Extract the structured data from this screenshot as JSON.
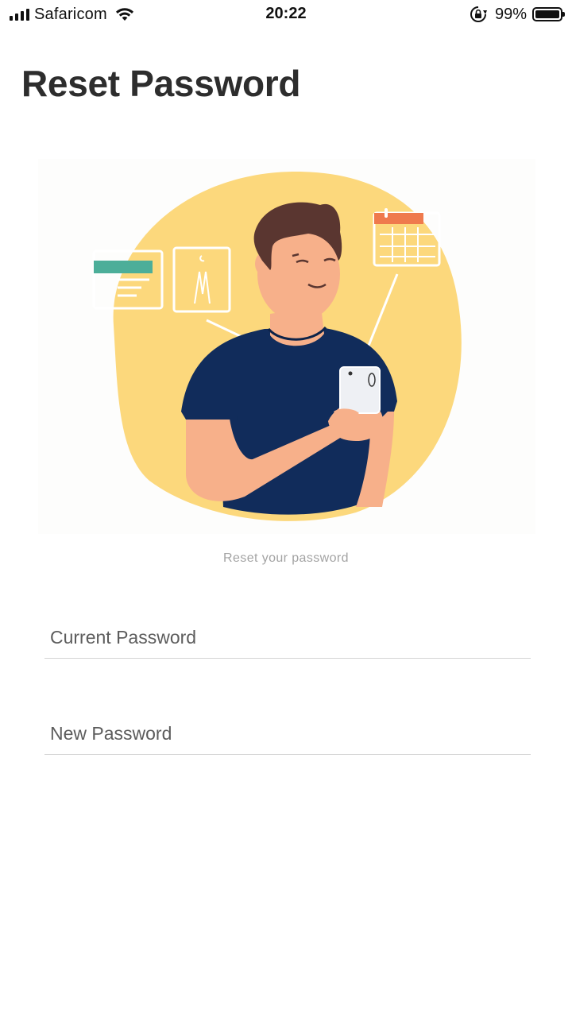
{
  "status_bar": {
    "carrier": "Safaricom",
    "time": "20:22",
    "battery_percent": "99%",
    "battery_level": 0.99,
    "signal_bars": 4,
    "icons": [
      "signal-icon",
      "wifi-icon",
      "rotation-lock-icon",
      "battery-icon"
    ]
  },
  "header": {
    "title": "Reset Password"
  },
  "illustration": {
    "subject": "man holding phone",
    "colors": {
      "blob": "#fcd87c",
      "shirt": "#112c5b",
      "skin": "#f7b08a",
      "hair": "#5a3630",
      "calendar_accent": "#ef7a4d",
      "card_accent": "#4cae99"
    }
  },
  "form": {
    "subtitle": "Reset your password",
    "current_password": {
      "placeholder": "Current Password",
      "value": ""
    },
    "new_password": {
      "placeholder": "New Password",
      "value": ""
    }
  }
}
